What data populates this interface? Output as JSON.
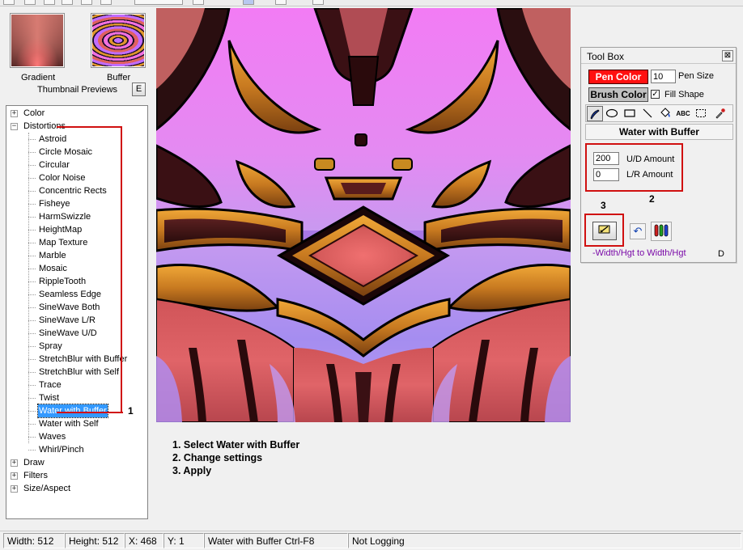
{
  "thumbnails": {
    "items": [
      {
        "id": "gradient",
        "caption": "Gradient"
      },
      {
        "id": "buffer",
        "caption": "Buffer"
      }
    ],
    "label": "Thumbnail Previews",
    "button": "E"
  },
  "tree": {
    "categories": [
      {
        "label": "Color",
        "expanded": false
      },
      {
        "label": "Distortions",
        "expanded": true
      },
      {
        "label": "Draw",
        "expanded": false
      },
      {
        "label": "Filters",
        "expanded": false
      },
      {
        "label": "Size/Aspect",
        "expanded": false
      }
    ],
    "distortions": [
      "Astroid",
      "Circle Mosaic",
      "Circular",
      "Color Noise",
      "Concentric Rects",
      "Fisheye",
      "HarmSwizzle",
      "HeightMap",
      "Map Texture",
      "Marble",
      "Mosaic",
      "RippleTooth",
      "Seamless Edge",
      "SineWave Both",
      "SineWave L/R",
      "SineWave U/D",
      "Spray",
      "StretchBlur with Buffer",
      "StretchBlur with Self",
      "Trace",
      "Twist",
      "Water with Buffer",
      "Water with Self",
      "Waves",
      "Whirl/Pinch"
    ],
    "selected": "Water with Buffer"
  },
  "annotations": {
    "step1": "1",
    "step2": "2",
    "step3": "3",
    "color": "#d01010"
  },
  "instructions": [
    "1. Select Water with Buffer",
    "2. Change settings",
    "3. Apply"
  ],
  "toolbox": {
    "title": "Tool Box",
    "close": "⊠",
    "pen_color_label": "Pen Color",
    "pen_color": "#ff1010",
    "brush_color_label": "Brush Color",
    "pen_size_value": "10",
    "pen_size_label": "Pen Size",
    "fill_shape_label": "Fill Shape",
    "fill_shape_checked": true,
    "tools": [
      "pen",
      "ellipse",
      "rectangle",
      "line",
      "fill",
      "text",
      "select",
      "eyedropper"
    ],
    "text_tool_glyph": "ABC",
    "filter_name": "Water with Buffer",
    "ud_amount_value": "200",
    "ud_amount_label": "U/D Amount",
    "lr_amount_value": "0",
    "lr_amount_label": "L/R Amount",
    "undo_glyph": "↶",
    "footer": "-Width/Hgt to Width/Hgt",
    "footer_right": "D"
  },
  "statusbar": {
    "width": "Width: 512",
    "height": "Height: 512",
    "x": "X: 468",
    "y": "Y: 1",
    "filter": "Water with Buffer Ctrl-F8",
    "logging": "Not Logging"
  }
}
